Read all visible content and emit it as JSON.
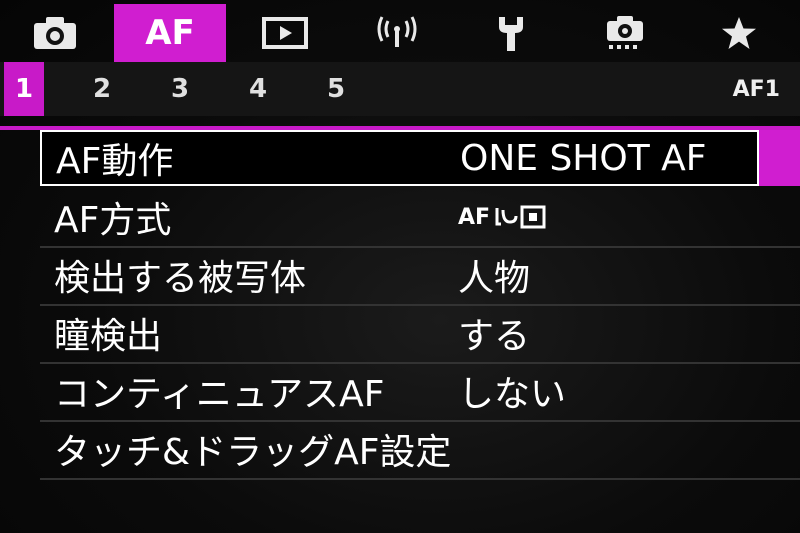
{
  "tabs": [
    {
      "icon": "camera-icon"
    },
    {
      "label": "AF",
      "active": true
    },
    {
      "icon": "playback-icon"
    },
    {
      "icon": "wireless-icon"
    },
    {
      "icon": "wrench-icon"
    },
    {
      "icon": "custom-function-camera-icon"
    },
    {
      "icon": "star-icon"
    }
  ],
  "af_tab_label": "AF",
  "subtabs": [
    "1",
    "2",
    "3",
    "4",
    "5"
  ],
  "page_label": "AF1",
  "accent_color": "#d01ed0",
  "menu": {
    "items": [
      {
        "label": "AF動作",
        "value": "ONE SHOT AF"
      },
      {
        "label": "AF方式",
        "value_icon": "face-tracking-af-icon",
        "value_text": "AF"
      },
      {
        "label": "検出する被写体",
        "value": "人物"
      },
      {
        "label": "瞳検出",
        "value": "する"
      },
      {
        "label": "コンティニュアスAF",
        "value": "しない"
      },
      {
        "label": "タッチ&ドラッグAF設定",
        "value": ""
      }
    ]
  }
}
